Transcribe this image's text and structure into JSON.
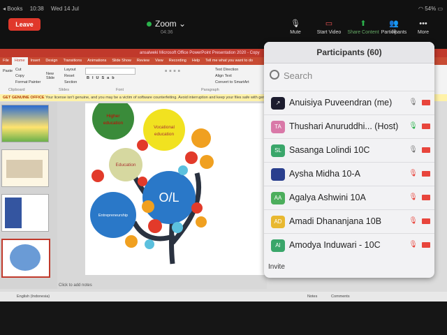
{
  "status_bar": {
    "back": "◂ Books",
    "time": "10:38",
    "date": "Wed 14 Jul",
    "battery": "54%"
  },
  "zoom": {
    "leave_label": "Leave",
    "title": "Zoom",
    "elapsed": "04:36",
    "toolbar": [
      {
        "label": "Mute",
        "icon": "mic-icon"
      },
      {
        "label": "Start Video",
        "icon": "video-off-icon"
      },
      {
        "label": "Share Content",
        "icon": "share-icon"
      },
      {
        "label": "Participants",
        "icon": "participants-icon",
        "count": "60"
      },
      {
        "label": "More",
        "icon": "more-icon"
      }
    ]
  },
  "ppt": {
    "title": "ansalweki Microsoft Office PowerPoint Presentation 2020 - Copy",
    "tabs": [
      "File",
      "Home",
      "Insert",
      "Design",
      "Transitions",
      "Animations",
      "Slide Show",
      "Review",
      "View",
      "Recording",
      "Help",
      "Tell me what you want to do"
    ],
    "ribbon": {
      "paste": "Paste",
      "cut": "Cut",
      "copy": "Copy",
      "format_painter": "Format Painter",
      "new_slide": "New Slide",
      "layout": "Layout",
      "reset": "Reset",
      "section": "Section",
      "clipboard": "Clipboard",
      "slides": "Slides",
      "font": "Font",
      "paragraph": "Paragraph",
      "text_direction": "Text Direction",
      "align_text": "Align Text",
      "convert": "Convert to SmartArt"
    },
    "banner": {
      "bold": "GET GENUINE OFFICE",
      "text": "Your license isn't genuine, and you may be a victim of software counterfeiting. Avoid interruption and keep your files safe with genuine Office"
    },
    "notes": "Click to add notes",
    "status_left": "English (Indonesia)",
    "status_notes": "Notes",
    "status_comments": "Comments",
    "slide": {
      "center": "O/L",
      "branches": [
        "Higher education",
        "Vocational education",
        "Education",
        "Entrepreneurship"
      ]
    }
  },
  "participants": {
    "title": "Participants (60)",
    "search_placeholder": "Search",
    "invite": "Invite",
    "list": [
      {
        "initials": "",
        "name": "Anuisiya Puveendran (me)",
        "color": "#1c1c2e",
        "mic": "on"
      },
      {
        "initials": "TA",
        "name": "Thushari Anuruddhi... (Host)",
        "color": "#d978a8",
        "mic": "active"
      },
      {
        "initials": "SL",
        "name": "Sasanga Lolindi 10C",
        "color": "#3aa66a",
        "mic": "on"
      },
      {
        "initials": "",
        "name": "Aysha Midha 10-A",
        "color": "#2a3f8e",
        "mic": "muted"
      },
      {
        "initials": "AA",
        "name": "Agalya Ashwini 10A",
        "color": "#4cae5c",
        "mic": "muted"
      },
      {
        "initials": "AD",
        "name": "Amadi Dhananjana 10B",
        "color": "#e8b830",
        "mic": "muted"
      },
      {
        "initials": "AI",
        "name": "Amodya Induwari - 10C",
        "color": "#3aa66a",
        "mic": "muted"
      }
    ]
  }
}
